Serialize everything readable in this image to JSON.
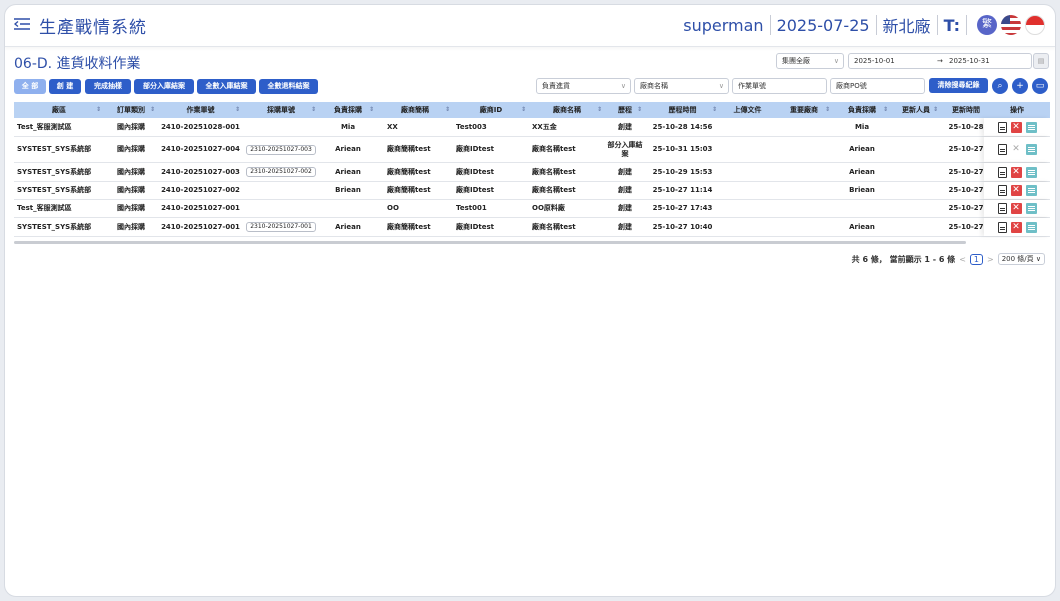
{
  "app": {
    "title": "生產戰情系統",
    "user": "superman",
    "date": "2025-07-25",
    "factory": "新北廠",
    "lang_badge": "繁",
    "font_icon": "T:"
  },
  "page": {
    "title": "06-D. 進貨收料作業"
  },
  "filters": {
    "group": "集團全廠",
    "date_from": "2025-10-01",
    "date_arrow": "→",
    "date_to": "2025-10-31",
    "owner": "負責進貨",
    "vendor": "廠商名稱",
    "doc_no_placeholder": "作業單號",
    "po_placeholder": "廠商PO號",
    "clear_btn": "清除搜尋紀錄"
  },
  "status_buttons": [
    "全 部",
    "創 建",
    "完成抽樣",
    "部分入庫結案",
    "全數入庫結案",
    "全數退料結案"
  ],
  "columns": [
    "廠區",
    "訂單類別",
    "作業單號",
    "採購單號",
    "負責採購",
    "廠商簡稱",
    "廠商ID",
    "廠商名稱",
    "歷程",
    "歷程時間",
    "上傳文件",
    "重要廠商",
    "負責採購",
    "更新人員",
    "更新時間",
    "操作"
  ],
  "rows": [
    [
      "Test_客服測試區",
      "國內採購",
      "2410-20251028-001",
      "",
      "Mia",
      "XX",
      "Test003",
      "XX五金",
      "創建",
      "25-10-28 14:56",
      "",
      "",
      "Mia",
      "",
      "25-10-28"
    ],
    [
      "SYSTEST_SYS系統部",
      "國內採購",
      "2410-20251027-004",
      "2310-20251027-003",
      "Ariean",
      "廠商簡稱test",
      "廠商IDtest",
      "廠商名稱test",
      "部分入庫結案",
      "25-10-31 15:03",
      "",
      "",
      "Ariean",
      "",
      "25-10-27"
    ],
    [
      "SYSTEST_SYS系統部",
      "國內採購",
      "2410-20251027-003",
      "2310-20251027-002",
      "Ariean",
      "廠商簡稱test",
      "廠商IDtest",
      "廠商名稱test",
      "創建",
      "25-10-29 15:53",
      "",
      "",
      "Ariean",
      "",
      "25-10-27"
    ],
    [
      "SYSTEST_SYS系統部",
      "國內採購",
      "2410-20251027-002",
      "",
      "Briean",
      "廠商簡稱test",
      "廠商IDtest",
      "廠商名稱test",
      "創建",
      "25-10-27 11:14",
      "",
      "",
      "Briean",
      "",
      "25-10-27"
    ],
    [
      "Test_客服測試區",
      "國內採購",
      "2410-20251027-001",
      "",
      "",
      "OO",
      "Test001",
      "OO原料廠",
      "創建",
      "25-10-27 17:43",
      "",
      "",
      "",
      "",
      "25-10-27"
    ],
    [
      "SYSTEST_SYS系統部",
      "國內採購",
      "2410-20251027-001",
      "2310-20251027-001",
      "Ariean",
      "廠商簡稱test",
      "廠商IDtest",
      "廠商名稱test",
      "創建",
      "25-10-27 10:40",
      "",
      "",
      "Ariean",
      "",
      "25-10-27"
    ]
  ],
  "pagination": {
    "summary": "共 6 條， 當前顯示 1 - 6 條",
    "prev": "<",
    "page": "1",
    "next": ">",
    "page_size": "200 條/頁"
  }
}
